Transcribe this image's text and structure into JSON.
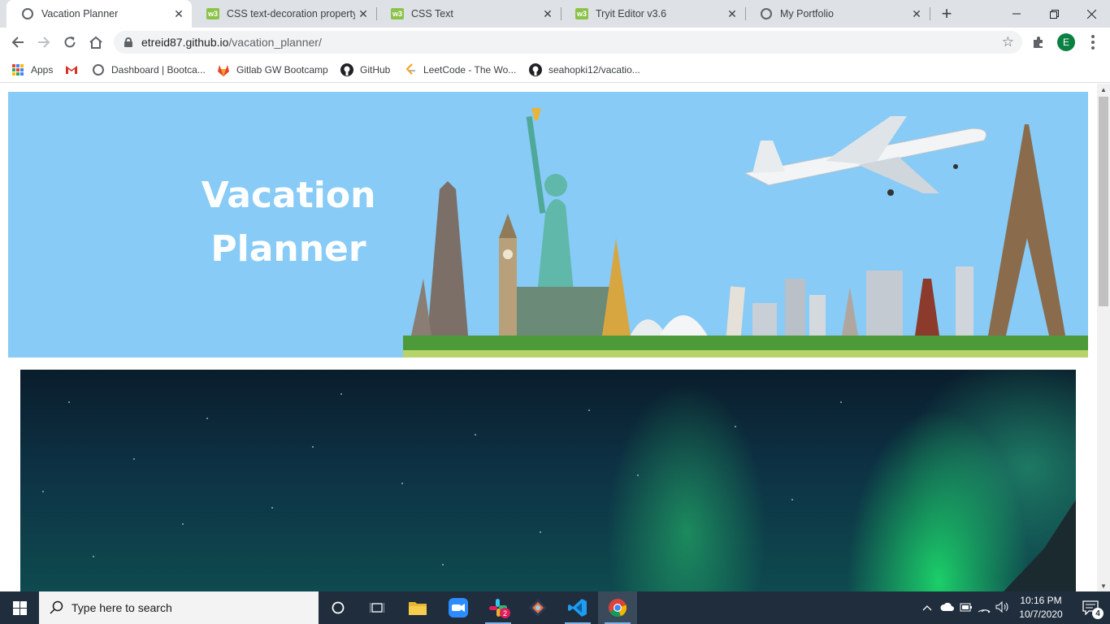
{
  "browser": {
    "tabs": [
      {
        "title": "Vacation Planner",
        "icon": "globe-icon",
        "active": true
      },
      {
        "title": "CSS text-decoration property",
        "icon": "w3schools-icon",
        "active": false
      },
      {
        "title": "CSS Text",
        "icon": "w3schools-icon",
        "active": false
      },
      {
        "title": "Tryit Editor v3.6",
        "icon": "w3schools-icon",
        "active": false
      },
      {
        "title": "My Portfolio",
        "icon": "globe-icon",
        "active": false
      }
    ],
    "address": {
      "domain": "etreid87.github.io",
      "path": "/vacation_planner/"
    },
    "profile_initial": "E",
    "bookmarks": [
      {
        "label": "Apps",
        "icon": "apps-grid-icon"
      },
      {
        "label": "",
        "icon": "gmail-icon"
      },
      {
        "label": "Dashboard | Bootca...",
        "icon": "globe-icon"
      },
      {
        "label": "Gitlab GW Bootcamp",
        "icon": "gitlab-icon"
      },
      {
        "label": "GitHub",
        "icon": "github-icon"
      },
      {
        "label": "LeetCode - The Wo...",
        "icon": "leetcode-icon"
      },
      {
        "label": "seahopki12/vacatio...",
        "icon": "github-icon"
      }
    ]
  },
  "page": {
    "hero_title_line1": "Vacation",
    "hero_title_line2": "Planner",
    "hero_bg_color": "#87cbf6"
  },
  "taskbar": {
    "search_placeholder": "Type here to search",
    "time": "10:16 PM",
    "date": "10/7/2020",
    "notification_count": "4",
    "slack_badge": "2"
  }
}
